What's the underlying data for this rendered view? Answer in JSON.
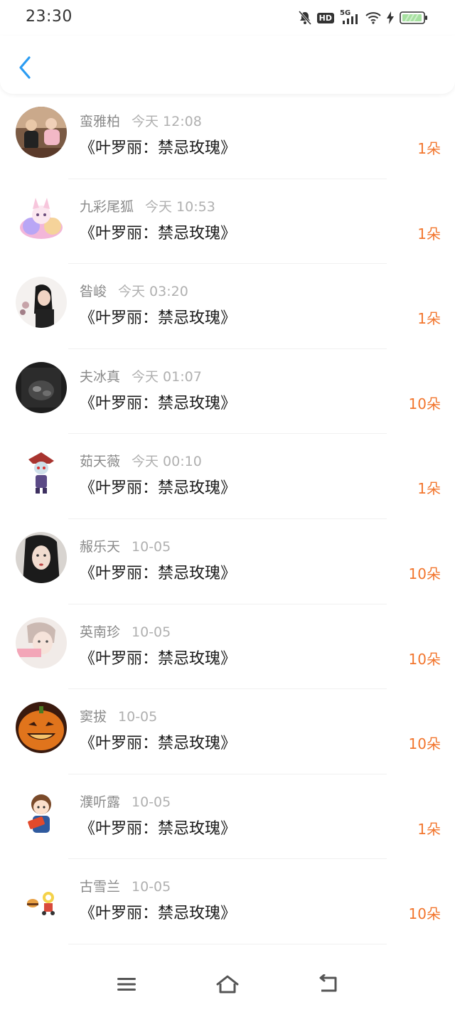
{
  "status_bar": {
    "time": "23:30",
    "icons": [
      "bell-muted-icon",
      "hd-icon",
      "5g-signal-icon",
      "wifi-icon",
      "charging-icon",
      "battery-icon"
    ],
    "hd_label": "HD",
    "network_label": "5G"
  },
  "header": {
    "back_icon": "chevron-left-icon",
    "accent_color": "#2b9cf2"
  },
  "gifts": [
    {
      "name": "蛮雅柏",
      "time": "今天 12:08",
      "title": "《叶罗丽：禁忌玫瑰》",
      "count": "1朵"
    },
    {
      "name": "九彩尾狐",
      "time": "今天 10:53",
      "title": "《叶罗丽：禁忌玫瑰》",
      "count": "1朵"
    },
    {
      "name": "昝峻",
      "time": "今天 03:20",
      "title": "《叶罗丽：禁忌玫瑰》",
      "count": "1朵"
    },
    {
      "name": "夫冰真",
      "time": "今天 01:07",
      "title": "《叶罗丽：禁忌玫瑰》",
      "count": "10朵"
    },
    {
      "name": "茹天薇",
      "time": "今天 00:10",
      "title": "《叶罗丽：禁忌玫瑰》",
      "count": "1朵"
    },
    {
      "name": "赧乐天",
      "time": "10-05",
      "title": "《叶罗丽：禁忌玫瑰》",
      "count": "10朵"
    },
    {
      "name": "英南珍",
      "time": "10-05",
      "title": "《叶罗丽：禁忌玫瑰》",
      "count": "10朵"
    },
    {
      "name": "窦拔",
      "time": "10-05",
      "title": "《叶罗丽：禁忌玫瑰》",
      "count": "10朵"
    },
    {
      "name": "濮听露",
      "time": "10-05",
      "title": "《叶罗丽：禁忌玫瑰》",
      "count": "1朵"
    },
    {
      "name": "古雪兰",
      "time": "10-05",
      "title": "《叶罗丽：禁忌玫瑰》",
      "count": "10朵"
    }
  ],
  "nav_bar": {
    "icons": [
      "menu-icon",
      "home-icon",
      "back-icon"
    ]
  },
  "colors": {
    "count": "#f2762e",
    "name": "#8a8a8a",
    "time": "#b0b0b0"
  }
}
